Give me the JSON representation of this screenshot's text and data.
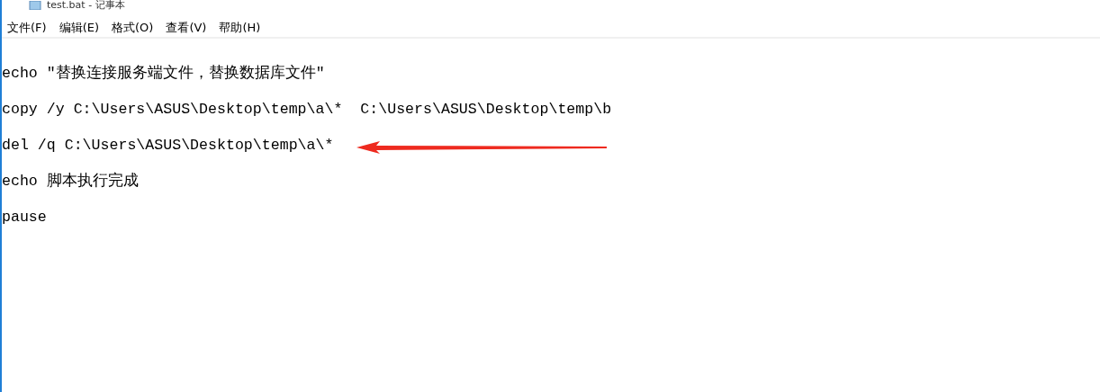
{
  "window": {
    "title": "test.bat - 记事本"
  },
  "menu": [
    {
      "label": "文件(F)"
    },
    {
      "label": "编辑(E)"
    },
    {
      "label": "格式(O)"
    },
    {
      "label": "查看(V)"
    },
    {
      "label": "帮助(H)"
    }
  ],
  "lines": [
    {
      "text": "echo \"替换连接服务端文件，替换数据库文件\"",
      "arrow": false
    },
    {
      "text": "copy /y C:\\Users\\ASUS\\Desktop\\temp\\a\\*  C:\\Users\\ASUS\\Desktop\\temp\\b",
      "arrow": false
    },
    {
      "text": "del /q C:\\Users\\ASUS\\Desktop\\temp\\a\\*",
      "arrow": true
    },
    {
      "text": "echo 脚本执行完成",
      "arrow": false
    },
    {
      "text": "pause",
      "arrow": false
    }
  ]
}
